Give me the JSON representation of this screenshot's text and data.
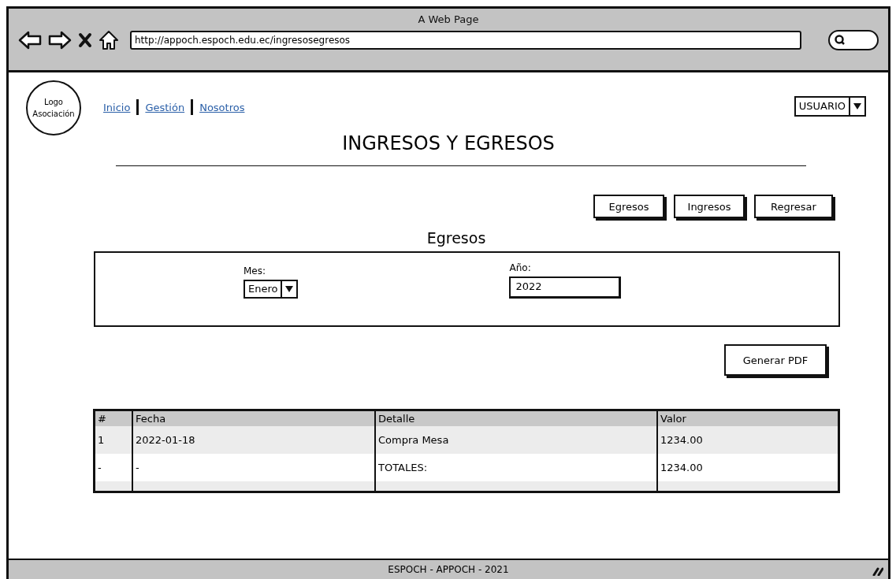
{
  "window": {
    "title": "A Web Page",
    "url": "http://appoch.espoch.edu.ec/ingresosegresos"
  },
  "header": {
    "logo": "Logo Asociación",
    "nav": [
      {
        "label": "Inicio"
      },
      {
        "label": "Gestión"
      },
      {
        "label": "Nosotros"
      }
    ],
    "user_menu": "USUARIO"
  },
  "page_title": "INGRESOS Y EGRESOS",
  "actions": [
    "Egresos",
    "Ingresos",
    "Regresar"
  ],
  "section_title": "Egresos",
  "filters": {
    "month": {
      "label": "Mes:",
      "value": "Enero"
    },
    "year": {
      "label": "Año:",
      "value": "2022"
    }
  },
  "pdf_button": "Generar PDF",
  "table": {
    "columns": [
      "#",
      "Fecha",
      "Detalle",
      "Valor"
    ],
    "rows": [
      {
        "cells": [
          "1",
          "2022-01-18",
          "Compra Mesa",
          "1234.00"
        ]
      },
      {
        "cells": [
          "-",
          "-",
          "TOTALES:",
          "1234.00"
        ]
      }
    ]
  },
  "status_bar": "ESPOCH - APPOCH - 2021"
}
